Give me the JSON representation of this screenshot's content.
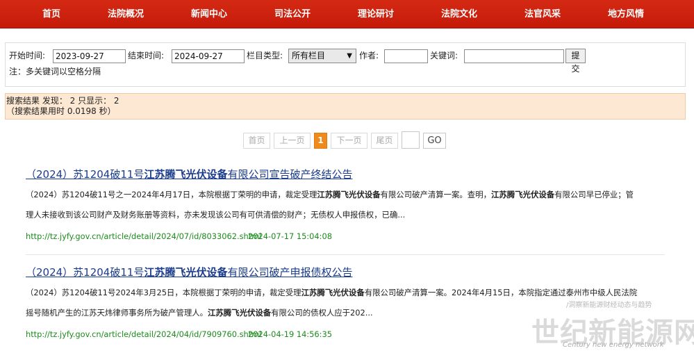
{
  "nav": {
    "items": [
      "首页",
      "法院概况",
      "新闻中心",
      "司法公开",
      "理论研讨",
      "法院文化",
      "法官风采",
      "地方风情"
    ]
  },
  "search": {
    "start_label": "开始时间:",
    "start_value": "2023-09-27",
    "end_label": "结束时间:",
    "end_value": "2024-09-27",
    "column_label": "栏目类型:",
    "column_value": "所有栏目",
    "author_label": "作者:",
    "author_value": "",
    "keyword_label": "关键词:",
    "keyword_value": "",
    "submit_label": "提交",
    "note": "注：多关键词以空格分隔"
  },
  "summary": {
    "line1": "搜索结果 发现： 2 只显示： 2",
    "line2": "（搜索结果用时 0.0198 秒）"
  },
  "pager": {
    "first": "首页",
    "prev": "上一页",
    "current": "1",
    "next": "下一页",
    "last": "尾页",
    "go": "GO"
  },
  "results": [
    {
      "title_pre": "（2024）苏1204破11号",
      "title_hl": "江苏腾飞光伏设备",
      "title_post": "有限公司宣告破产终结公告",
      "desc1_a": "（2024）苏1204破11号之一2024年4月17日，本院根据丁荣明的申请，裁定受理",
      "desc1_hl": "江苏腾飞光伏设备",
      "desc1_b": "有限公司破产清算一案。查明，",
      "desc1_hl2": "江苏腾飞光伏设备",
      "desc1_c": "有限公司早已停业；管",
      "desc2": "理人未接收到该公司财产及财务账册等资料，亦未发现该公司有可供清偿的财产；无债权人申报债权，已确...",
      "url": "http://tz.jyfy.gov.cn/article/detail/2024/07/id/8033062.shtml",
      "time": "2024-07-17 15:04:08"
    },
    {
      "title_pre": "（2024）苏1204破11号",
      "title_hl": "江苏腾飞光伏设备",
      "title_post": "有限公司破产申报债权公告",
      "desc1_a": "（2024）苏1204破11号2024年3月25日，本院根据丁荣明的申请，裁定受理",
      "desc1_hl": "江苏腾飞光伏设备",
      "desc1_b": "有限公司破产清算一案。2024年4月15日，本院指定通过泰州市中级人民法院",
      "desc2_a": "摇号随机产生的江苏天炜律师事务所为破产管理人。",
      "desc2_hl": "江苏腾飞光伏设备",
      "desc2_b": "有限公司的债权人应于202...",
      "url": "http://tz.jyfy.gov.cn/article/detail/2024/04/id/7909760.shtml",
      "time": "2024-04-19 14:56:35"
    }
  ],
  "watermark": {
    "sub": "/洞察新能源财经动态与趋势",
    "main": "世纪新能源网",
    "en": "Century new energy network"
  }
}
